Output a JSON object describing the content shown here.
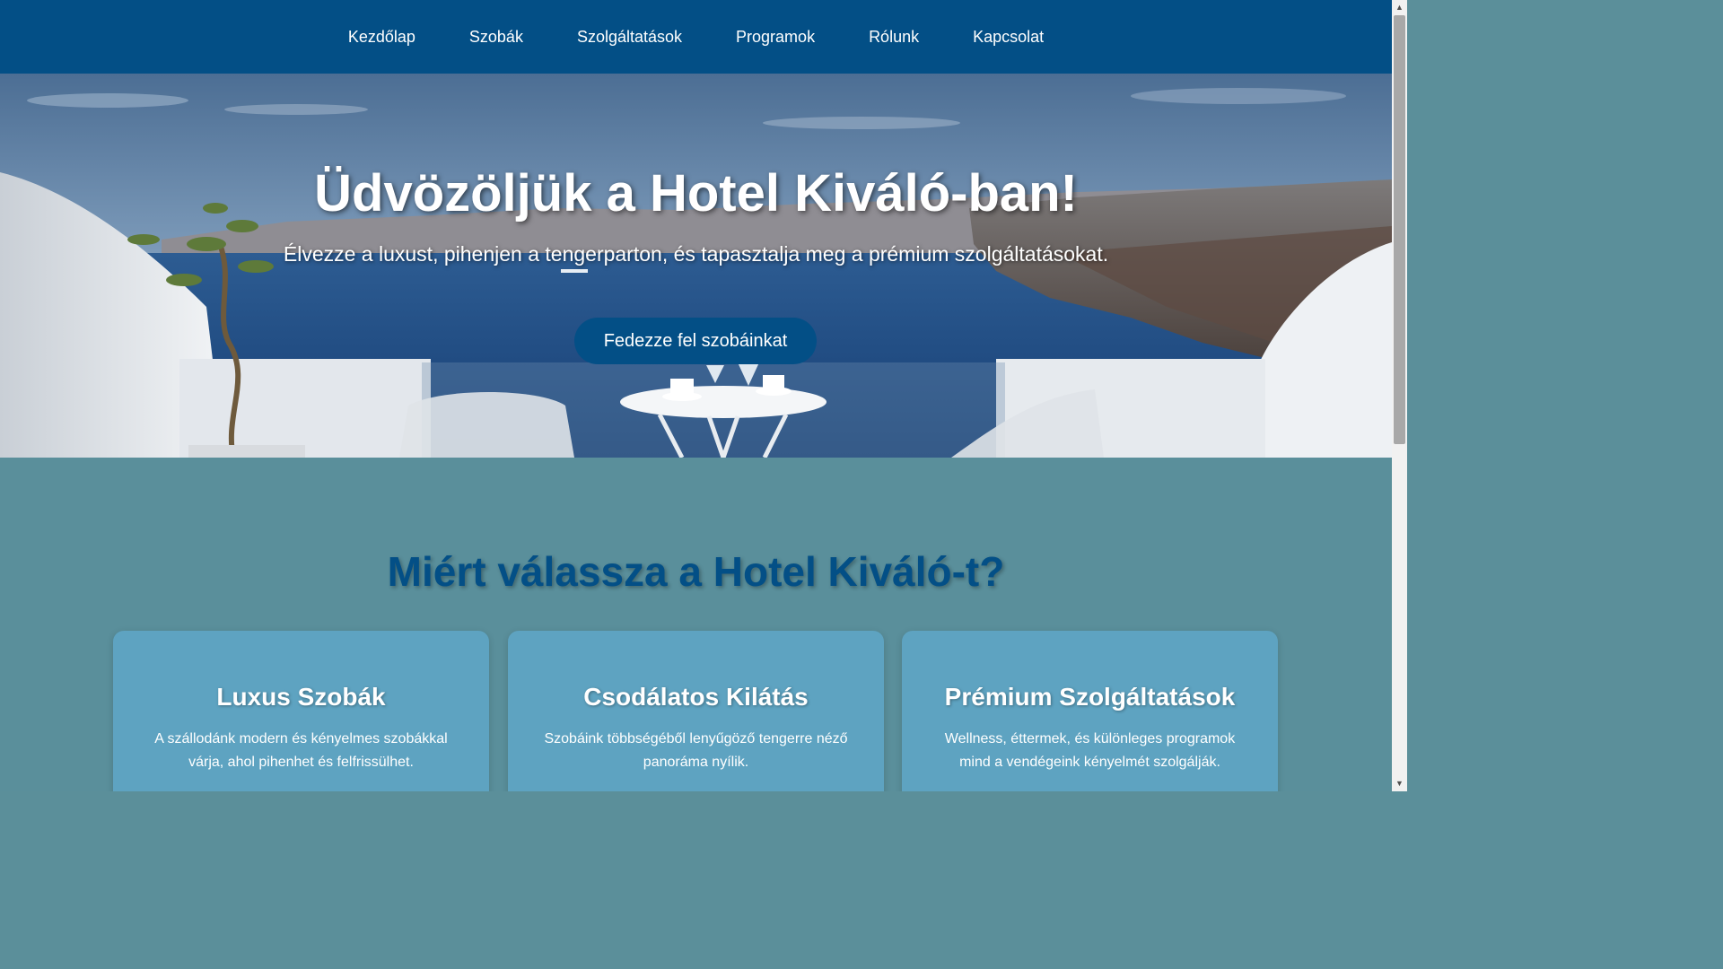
{
  "nav": {
    "items": [
      {
        "label": "Kezdőlap"
      },
      {
        "label": "Szobák"
      },
      {
        "label": "Szolgáltatások"
      },
      {
        "label": "Programok"
      },
      {
        "label": "Rólunk"
      },
      {
        "label": "Kapcsolat"
      }
    ]
  },
  "hero": {
    "title": "Üdvözöljük a Hotel Kiváló-ban!",
    "subtitle": "Élvezze a luxust, pihenjen a tengerparton, és tapasztalja meg a prémium szolgáltatásokat.",
    "cta_label": "Fedezze fel szobáinkat"
  },
  "features": {
    "title": "Miért válassza a Hotel Kiváló-t?",
    "cards": [
      {
        "title": "Luxus Szobák",
        "text": "A szállodánk modern és kényelmes szobákkal várja, ahol pihenhet és felfrissülhet."
      },
      {
        "title": "Csodálatos Kilátás",
        "text": "Szobáink többségéből lenyűgöző tengerre néző panoráma nyílik."
      },
      {
        "title": "Prémium Szolgáltatások",
        "text": "Wellness, éttermek, és különleges programok mind a vendégeink kényelmét szolgálják."
      }
    ]
  },
  "colors": {
    "nav_bg": "#034f86",
    "features_bg": "#5a8f9b",
    "card_bg": "#5ea3c1",
    "accent": "#034f86"
  },
  "icons": {
    "scroll_up": "▲",
    "scroll_down": "▼"
  }
}
